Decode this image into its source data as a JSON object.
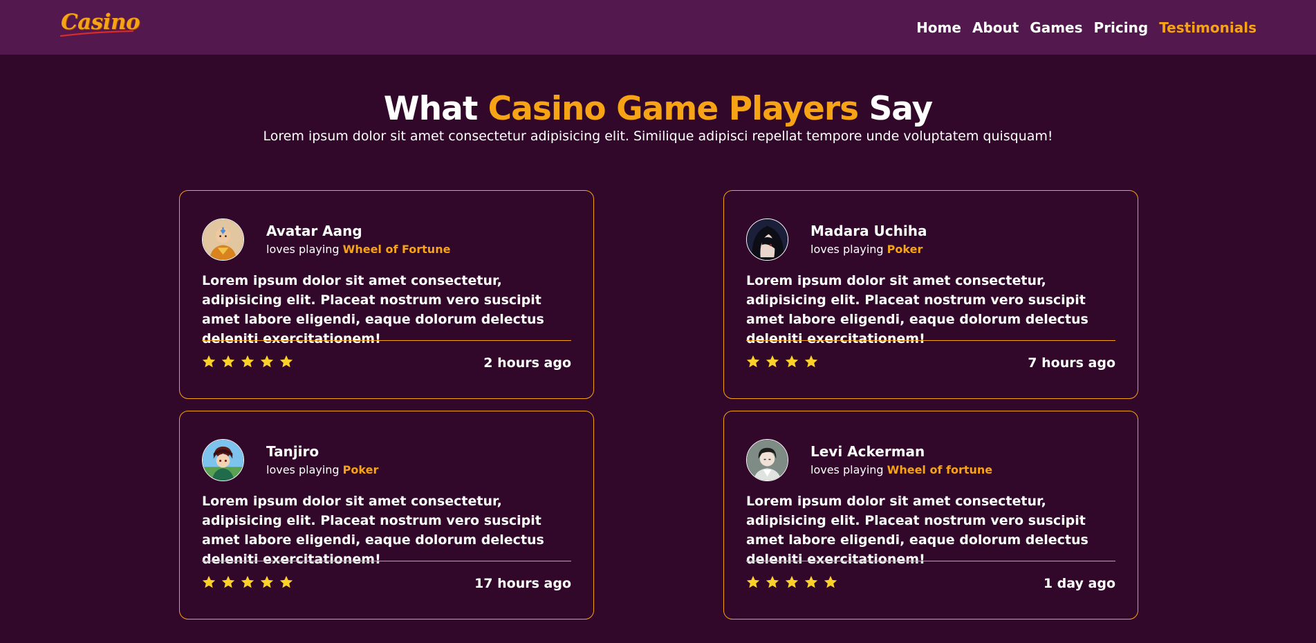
{
  "brand": {
    "logo_text": "Casino",
    "colors": {
      "accent": "#f7a316",
      "nav_bg": "#53184e",
      "page_bg": "#32082a"
    }
  },
  "nav": {
    "items": [
      {
        "label": "Home",
        "active": false
      },
      {
        "label": "About",
        "active": false
      },
      {
        "label": "Games",
        "active": false
      },
      {
        "label": "Pricing",
        "active": false
      },
      {
        "label": "Testimonials",
        "active": true
      }
    ]
  },
  "hero": {
    "title_part1": "What ",
    "title_accent": "Casino Game Players",
    "title_part2": " Say",
    "subtitle": "Lorem ipsum dolor sit amet consectetur adipisicing elit. Similique adipisci repellat tempore unde voluptatem quisquam!"
  },
  "testimonials": [
    {
      "name": "Avatar Aang",
      "loves_prefix": "loves playing ",
      "game": "Wheel of Fortune",
      "review": "Lorem ipsum dolor sit amet consectetur, adipisicing elit. Placeat nostrum vero suscipit amet labore eligendi, eaque dolorum delectus deleniti exercitationem!",
      "rating": 5,
      "time": "2 hours ago",
      "avatar_icon": "avatar-aang-icon"
    },
    {
      "name": "Madara Uchiha",
      "loves_prefix": "loves playing ",
      "game": "Poker",
      "review": "Lorem ipsum dolor sit amet consectetur, adipisicing elit. Placeat nostrum vero suscipit amet labore eligendi, eaque dolorum delectus deleniti exercitationem!",
      "rating": 4,
      "time": "7 hours ago",
      "avatar_icon": "avatar-madara-icon"
    },
    {
      "name": "Tanjiro",
      "loves_prefix": "loves playing ",
      "game": "Poker",
      "review": "Lorem ipsum dolor sit amet consectetur, adipisicing elit. Placeat nostrum vero suscipit amet labore eligendi, eaque dolorum delectus deleniti exercitationem!",
      "rating": 5,
      "time": "17 hours ago",
      "avatar_icon": "avatar-tanjiro-icon"
    },
    {
      "name": "Levi Ackerman",
      "loves_prefix": "loves playing ",
      "game": "Wheel of fortune",
      "review": "Lorem ipsum dolor sit amet consectetur, adipisicing elit. Placeat nostrum vero suscipit amet labore eligendi, eaque dolorum delectus deleniti exercitationem!",
      "rating": 5,
      "time": "1 day ago",
      "avatar_icon": "avatar-levi-icon"
    }
  ]
}
